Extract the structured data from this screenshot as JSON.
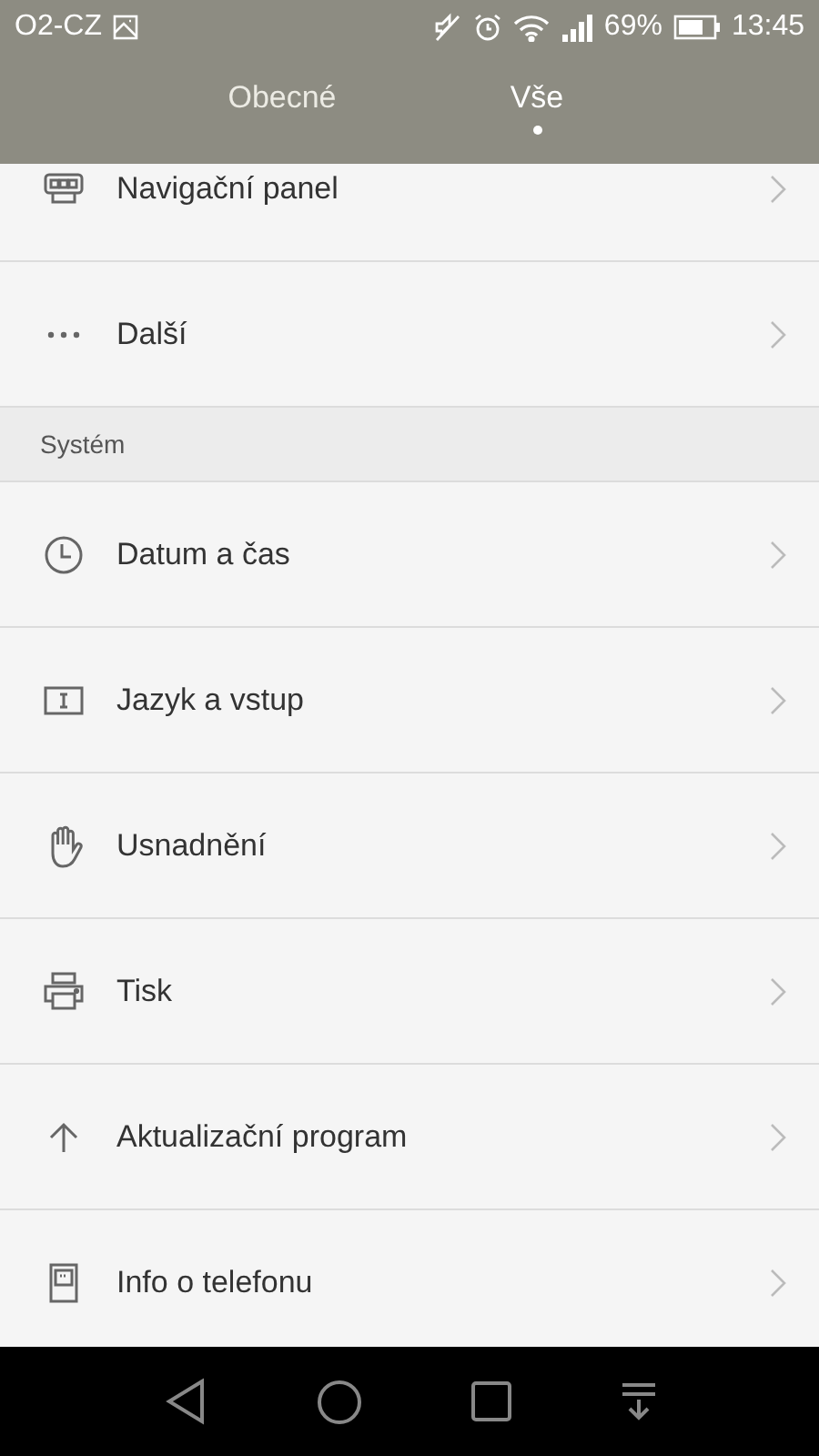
{
  "status_bar": {
    "carrier": "O2-CZ",
    "battery": "69%",
    "time": "13:45"
  },
  "tabs": [
    {
      "label": "Obecné",
      "selected": false
    },
    {
      "label": "Vše",
      "selected": true
    }
  ],
  "sections": [
    {
      "items": [
        {
          "label": "Navigační panel"
        },
        {
          "label": "Další"
        }
      ]
    },
    {
      "title": "Systém",
      "items": [
        {
          "label": "Datum a čas"
        },
        {
          "label": "Jazyk a vstup"
        },
        {
          "label": "Usnadnění"
        },
        {
          "label": "Tisk"
        },
        {
          "label": "Aktualizační program"
        },
        {
          "label": "Info o telefonu"
        }
      ]
    }
  ]
}
